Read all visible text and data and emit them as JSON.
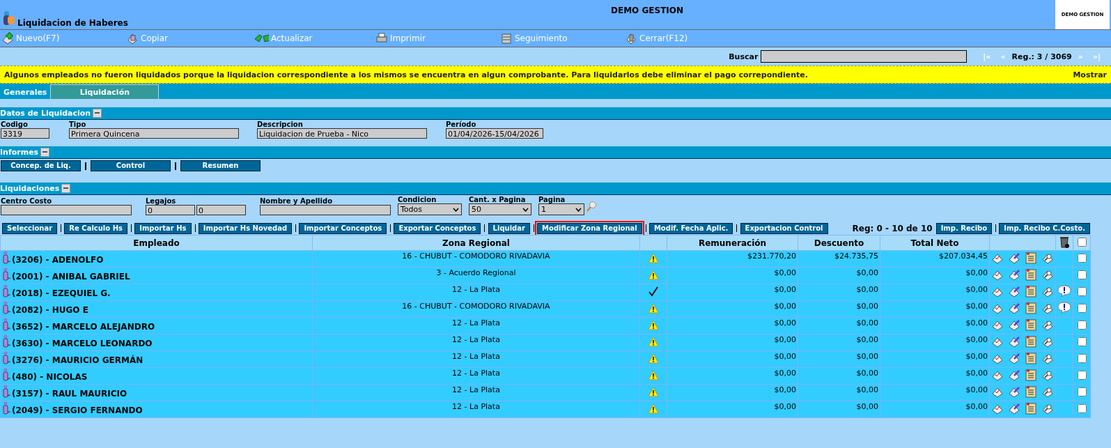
{
  "header": {
    "title": "Liquidacion de Haberes",
    "company": "DEMO GESTION",
    "logo_text": "DEMO GESTION"
  },
  "toolbar": [
    {
      "label": "Nuevo(F7)",
      "kind": "new"
    },
    {
      "label": "Copiar",
      "kind": "copy"
    },
    {
      "label": "Actualizar",
      "kind": "refresh"
    },
    {
      "label": "Imprimir",
      "kind": "print"
    },
    {
      "label": "Seguimiento",
      "kind": "track"
    },
    {
      "label": "Cerrar(F12)",
      "kind": "close"
    }
  ],
  "search": {
    "label": "Buscar",
    "first": "|«",
    "prev": "«",
    "record": "Reg.: 3 / 3069",
    "next": "»",
    "last": "»|"
  },
  "warning": {
    "text": "Algunos empleados no fueron liquidados porque la liquidacion correspondiente a los mismos se encuentra en algun comprobante. Para liquidarlos debe eliminar el pago correpondiente.",
    "action": "Mostrar"
  },
  "tabs": [
    {
      "label": "Generales",
      "selected": false
    },
    {
      "label": "Liquidación",
      "selected": true
    }
  ],
  "datos": {
    "title": "Datos de Liquidacion",
    "fields": [
      {
        "label": "Codigo",
        "value": "3319"
      },
      {
        "label": "Tipo",
        "value": "Primera Quincena"
      },
      {
        "label": "Descripcion",
        "value": "Liquidacion de Prueba - Nico"
      },
      {
        "label": "Período",
        "value": "01/04/2026-15/04/2026"
      }
    ]
  },
  "informes": {
    "title": "Informes",
    "buttons": [
      "Concep. de Liq.",
      "Control",
      "Resumen"
    ]
  },
  "liquidaciones": {
    "title": "Liquidaciones",
    "filters": [
      {
        "label": "Centro Costo",
        "kind": "input"
      },
      {
        "label": "Legajos",
        "kind": "range",
        "values": [
          "0",
          "0"
        ]
      },
      {
        "label": "Nombre y Apellido",
        "kind": "input"
      },
      {
        "label": "Condicion",
        "kind": "select",
        "values": [
          "Todos"
        ]
      },
      {
        "label": "Cant. x Pagina",
        "kind": "select",
        "values": [
          "50"
        ]
      },
      {
        "label": "Pagina",
        "kind": "select",
        "values": [
          "1"
        ]
      }
    ],
    "actions": [
      {
        "label": "Seleccionar",
        "highlighted": false
      },
      {
        "label": "Re Calculo Hs",
        "highlighted": false
      },
      {
        "label": "Importar Hs",
        "highlighted": false
      },
      {
        "label": "Importar Hs Novedad",
        "highlighted": false
      },
      {
        "label": "Importar Conceptos",
        "highlighted": false
      },
      {
        "label": "Exportar Conceptos",
        "highlighted": false
      },
      {
        "label": "Liquidar",
        "highlighted": false
      },
      {
        "label": "Modificar Zona Regional",
        "highlighted": true
      },
      {
        "label": "Modif. Fecha Aplic.",
        "highlighted": false
      },
      {
        "label": "Exportacion Control",
        "highlighted": false
      }
    ],
    "reg": "Reg: 0 - 10 de 10",
    "print_buttons": [
      "Imp. Recibo",
      "Imp. Recibo C.Costo."
    ]
  },
  "table": {
    "columns": [
      "Empleado",
      "Zona Regional",
      "Remuneración",
      "Descuento",
      "Total Neto"
    ],
    "all_checked": false,
    "rows": [
      {
        "employee": "(3206) - ADENOLFO",
        "zone": "16 - CHUBUT - COMODORO RIVADAVIA",
        "liquidated": false,
        "remuneracion": "$231.770,20",
        "descuento": "$24.735,75",
        "neto": "$207.034,45",
        "alert": false,
        "checked": false
      },
      {
        "employee": "(2001) - ANIBAL GABRIEL",
        "zone": "3 - Acuerdo Regional",
        "liquidated": false,
        "remuneracion": "$0,00",
        "descuento": "$0,00",
        "neto": "$0,00",
        "alert": false,
        "checked": false
      },
      {
        "employee": "(2018) - EZEQUIEL G.",
        "zone": "12 - La Plata",
        "liquidated": true,
        "remuneracion": "$0,00",
        "descuento": "$0,00",
        "neto": "$0,00",
        "alert": true,
        "checked": false
      },
      {
        "employee": "(2082) - HUGO E",
        "zone": "16 - CHUBUT - COMODORO RIVADAVIA",
        "liquidated": false,
        "remuneracion": "$0,00",
        "descuento": "$0,00",
        "neto": "$0,00",
        "alert": true,
        "checked": false
      },
      {
        "employee": "(3652) - MARCELO ALEJANDRO",
        "zone": "12 - La Plata",
        "liquidated": false,
        "remuneracion": "$0,00",
        "descuento": "$0,00",
        "neto": "$0,00",
        "alert": false,
        "checked": false
      },
      {
        "employee": "(3630) - MARCELO LEONARDO",
        "zone": "12 - La Plata",
        "liquidated": false,
        "remuneracion": "$0,00",
        "descuento": "$0,00",
        "neto": "$0,00",
        "alert": false,
        "checked": false
      },
      {
        "employee": "(3276) - MAURICIO GERMÁN",
        "zone": "12 - La Plata",
        "liquidated": false,
        "remuneracion": "$0,00",
        "descuento": "$0,00",
        "neto": "$0,00",
        "alert": false,
        "checked": false
      },
      {
        "employee": "(480) - NICOLAS",
        "zone": "12 - La Plata",
        "liquidated": false,
        "remuneracion": "$0,00",
        "descuento": "$0,00",
        "neto": "$0,00",
        "alert": false,
        "checked": false
      },
      {
        "employee": "(3157) - RAUL MAURICIO",
        "zone": "12 - La Plata",
        "liquidated": false,
        "remuneracion": "$0,00",
        "descuento": "$0,00",
        "neto": "$0,00",
        "alert": false,
        "checked": false
      },
      {
        "employee": "(2049) - SERGIO FERNANDO",
        "zone": "12 - La Plata",
        "liquidated": false,
        "remuneracion": "$0,00",
        "descuento": "$0,00",
        "neto": "$0,00",
        "alert": false,
        "checked": false
      }
    ]
  }
}
